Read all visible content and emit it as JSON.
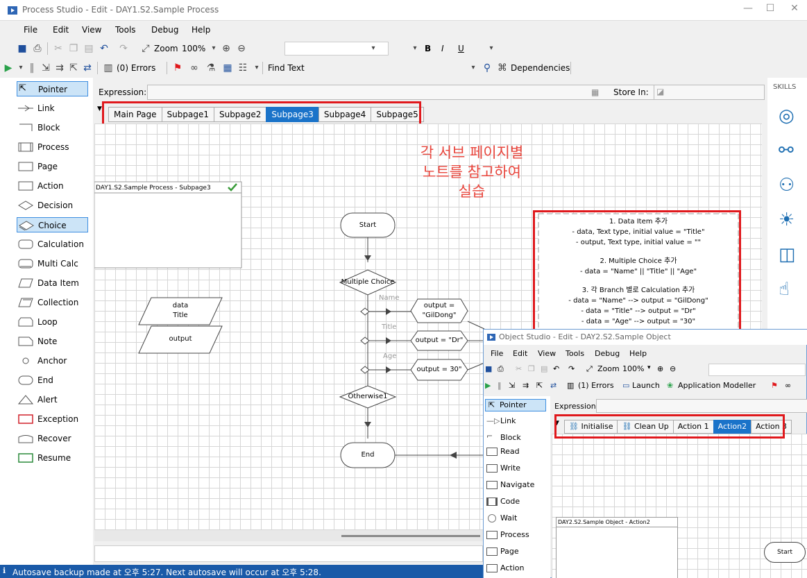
{
  "window": {
    "title": "Process Studio  - Edit - DAY1.S2.Sample Process",
    "minimize": "—",
    "maximize": "☐",
    "close": "✕"
  },
  "menu": [
    "File",
    "Edit",
    "View",
    "Tools",
    "Debug",
    "Help"
  ],
  "toolbar1": {
    "zoom_label": "Zoom",
    "zoom_value": "100%",
    "bold": "B",
    "italic": "I",
    "underline": "U"
  },
  "toolbar2": {
    "errors": "(0) Errors",
    "find_text": "Find Text",
    "dependencies": "Dependencies"
  },
  "palette": [
    "Pointer",
    "Link",
    "Block",
    "Process",
    "Page",
    "Action",
    "Decision",
    "Choice",
    "Calculation",
    "Multi Calc",
    "Data Item",
    "Collection",
    "Loop",
    "Note",
    "Anchor",
    "End",
    "Alert",
    "Exception",
    "Recover",
    "Resume"
  ],
  "expression": {
    "label": "Expression:",
    "store_in": "Store In:"
  },
  "tabs": [
    "Main Page",
    "Subpage1",
    "Subpage2",
    "Subpage3",
    "Subpage4",
    "Subpage5"
  ],
  "active_tab": "Subpage3",
  "skills": {
    "header": "SKILLS"
  },
  "page_info_title": "DAY1.S2.Sample Process - Subpage3",
  "korean_instruction": [
    "각 서브 페이지별",
    "노트를 참고하여",
    "실습"
  ],
  "flow": {
    "start": "Start",
    "choice": "Multiple Choice",
    "branches": [
      "Name",
      "Title",
      "Age"
    ],
    "calcs": [
      "output =\n\"GilDong\"",
      "output = \"Dr\"",
      "output = 30\""
    ],
    "otherwise": "Otherwise1",
    "end": "End",
    "data_item_1": [
      "data",
      "Title"
    ],
    "data_item_2": "output"
  },
  "note": [
    "1. Data Item 추가",
    "- data, Text type, initial value = \"Title\"",
    "- output, Text type, initial value = \"\"",
    "",
    "2. Multiple Choice 추가",
    "- data = \"Name\" || \"Title\" || \"Age\"",
    "",
    "3. 각 Branch 별로 Calculation 추가",
    "- data = \"Name\" --> output = \"GilDong\"",
    "- data = \"Title\" --> output = \"Dr\"",
    "- data = \"Age\" --> output = \"30\""
  ],
  "status": "Autosave backup made at 오후 5:27. Next autosave will occur at 오후 5:28.",
  "object_studio": {
    "title": "Object Studio  - Edit - DAY2.S2.Sample Object",
    "menu": [
      "File",
      "Edit",
      "View",
      "Tools",
      "Debug",
      "Help"
    ],
    "zoom_label": "Zoom",
    "zoom_value": "100%",
    "errors": "(1) Errors",
    "launch": "Launch",
    "app_modeller": "Application Modeller",
    "palette": [
      "Pointer",
      "Link",
      "Block",
      "Read",
      "Write",
      "Navigate",
      "Code",
      "Wait",
      "Process",
      "Page",
      "Action"
    ],
    "expression_label": "Expression:",
    "tabs": [
      "Initialise",
      "Clean Up",
      "Action 1",
      "Action2",
      "Action 3"
    ],
    "active_tab": "Action2",
    "page_info_title": "DAY2.S2.Sample Object - Action2",
    "start": "Start"
  }
}
